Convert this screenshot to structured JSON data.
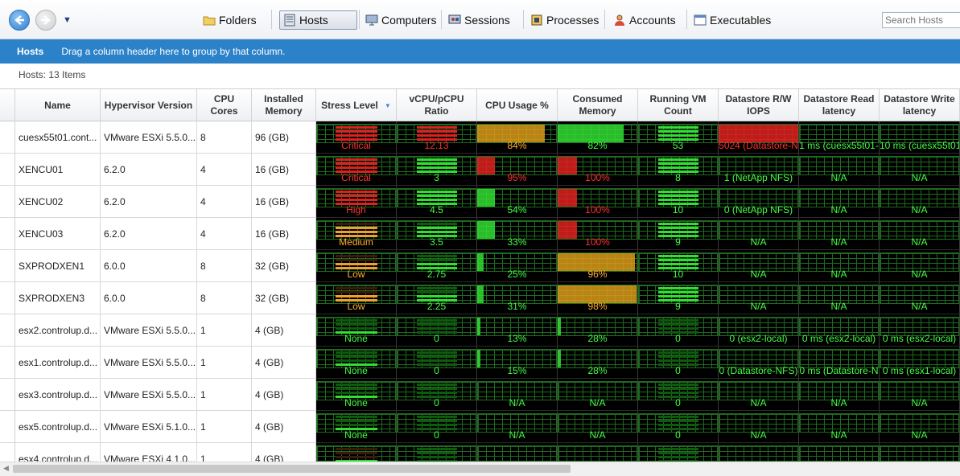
{
  "toolbar": {
    "tabs": [
      {
        "label": "Folders",
        "icon": "folder-icon"
      },
      {
        "label": "Hosts",
        "icon": "hosts-icon"
      },
      {
        "label": "Computers",
        "icon": "computer-icon"
      },
      {
        "label": "Sessions",
        "icon": "sessions-icon"
      },
      {
        "label": "Processes",
        "icon": "processes-icon"
      },
      {
        "label": "Accounts",
        "icon": "accounts-icon"
      },
      {
        "label": "Executables",
        "icon": "executables-icon"
      }
    ],
    "active_tab": "Hosts",
    "search_placeholder": "Search Hosts"
  },
  "groupbar": {
    "title": "Hosts",
    "hint": "Drag a column header here to group by that column."
  },
  "count_label": "Hosts: 13 Items",
  "columns": [
    "Name",
    "Hypervisor Version",
    "CPU Cores",
    "Installed Memory",
    "Stress Level",
    "vCPU/pCPU Ratio",
    "CPU Usage %",
    "Consumed Memory",
    "Running VM Count",
    "Datastore R/W IOPS",
    "Datastore Read latency",
    "Datastore Write latency"
  ],
  "sorted_column": "Stress Level",
  "colors": {
    "accent": "#2c82c9",
    "critical": "#e02020",
    "medium": "#f0a030",
    "ok": "#33dd33",
    "warn_fill": "#d99a1a",
    "label_green": "#44ff44",
    "label_red": "#ff3030",
    "label_orange": "#ffb030"
  },
  "rows": [
    {
      "name": "cuesx55t01.cont...",
      "hypervisor": "VMware ESXi 5.5.0...",
      "cores": "8",
      "memory": "96 (GB)",
      "stress": "Critical",
      "stress_level": 5,
      "ratio": "12.13",
      "ratio_bars": 4,
      "ratio_state": "red",
      "cpu": "84%",
      "cpu_pct": 84,
      "mem": "82%",
      "mem_pct": 82,
      "vms": "53",
      "vm_bars": 4,
      "iops": "5024 (Datastore-N",
      "iops_state": "red",
      "read": "1 ms (cuesx55t01-",
      "write": "10 ms (cuesx55t01"
    },
    {
      "name": "XENCU01",
      "hypervisor": "6.2.0",
      "cores": "4",
      "memory": "16 (GB)",
      "stress": "Critical",
      "stress_level": 5,
      "ratio": "3",
      "ratio_bars": 4,
      "ratio_state": "green",
      "cpu": "95%",
      "cpu_pct": 22,
      "mem": "100%",
      "mem_pct": 24,
      "vms": "8",
      "vm_bars": 4,
      "iops": "1 (NetApp NFS)",
      "iops_state": "green",
      "read": "N/A",
      "write": "N/A"
    },
    {
      "name": "XENCU02",
      "hypervisor": "6.2.0",
      "cores": "4",
      "memory": "16 (GB)",
      "stress": "High",
      "stress_level": 4,
      "ratio": "4.5",
      "ratio_bars": 4,
      "ratio_state": "green",
      "cpu": "54%",
      "cpu_pct": 22,
      "mem": "100%",
      "mem_pct": 24,
      "vms": "10",
      "vm_bars": 4,
      "iops": "0 (NetApp NFS)",
      "iops_state": "green",
      "read": "N/A",
      "write": "N/A"
    },
    {
      "name": "XENCU03",
      "hypervisor": "6.2.0",
      "cores": "4",
      "memory": "16 (GB)",
      "stress": "Medium",
      "stress_level": 3,
      "ratio": "3.5",
      "ratio_bars": 3,
      "ratio_state": "green",
      "cpu": "33%",
      "cpu_pct": 22,
      "mem": "100%",
      "mem_pct": 24,
      "vms": "9",
      "vm_bars": 4,
      "iops": "N/A",
      "iops_state": "green",
      "read": "N/A",
      "write": "N/A"
    },
    {
      "name": "SXPRODXEN1",
      "hypervisor": "6.0.0",
      "cores": "8",
      "memory": "32 (GB)",
      "stress": "Low",
      "stress_level": 2,
      "ratio": "2.75",
      "ratio_bars": 2,
      "ratio_state": "green",
      "cpu": "25%",
      "cpu_pct": 8,
      "mem": "96%",
      "mem_pct": 96,
      "vms": "10",
      "vm_bars": 4,
      "iops": "N/A",
      "iops_state": "green",
      "read": "N/A",
      "write": "N/A"
    },
    {
      "name": "SXPRODXEN3",
      "hypervisor": "6.0.0",
      "cores": "8",
      "memory": "32 (GB)",
      "stress": "Low",
      "stress_level": 2,
      "ratio": "2.25",
      "ratio_bars": 2,
      "ratio_state": "green",
      "cpu": "31%",
      "cpu_pct": 8,
      "mem": "98%",
      "mem_pct": 98,
      "vms": "9",
      "vm_bars": 4,
      "iops": "N/A",
      "iops_state": "green",
      "read": "N/A",
      "write": "N/A"
    },
    {
      "name": "esx2.controlup.d...",
      "hypervisor": "VMware ESXi 5.5.0...",
      "cores": "1",
      "memory": "4 (GB)",
      "stress": "None",
      "stress_level": 1,
      "ratio": "0",
      "ratio_bars": 0,
      "ratio_state": "green",
      "cpu": "13%",
      "cpu_pct": 4,
      "mem": "28%",
      "mem_pct": 4,
      "vms": "0",
      "vm_bars": 0,
      "iops": "0 (esx2-local)",
      "iops_state": "green",
      "read": "0 ms (esx2-local)",
      "write": "0 ms (esx2-local)"
    },
    {
      "name": "esx1.controlup.d...",
      "hypervisor": "VMware ESXi 5.5.0...",
      "cores": "1",
      "memory": "4 (GB)",
      "stress": "None",
      "stress_level": 1,
      "ratio": "0",
      "ratio_bars": 0,
      "ratio_state": "green",
      "cpu": "15%",
      "cpu_pct": 4,
      "mem": "28%",
      "mem_pct": 4,
      "vms": "0",
      "vm_bars": 0,
      "iops": "0 (Datastore-NFS)",
      "iops_state": "green",
      "read": "0 ms (Datastore-N",
      "write": "0 ms (esx1-local)"
    },
    {
      "name": "esx3.controlup.d...",
      "hypervisor": "VMware ESXi 5.5.0...",
      "cores": "1",
      "memory": "4 (GB)",
      "stress": "None",
      "stress_level": 1,
      "ratio": "0",
      "ratio_bars": 0,
      "ratio_state": "green",
      "cpu": "N/A",
      "cpu_pct": 0,
      "mem": "N/A",
      "mem_pct": 0,
      "vms": "0",
      "vm_bars": 0,
      "iops": "N/A",
      "iops_state": "green",
      "read": "N/A",
      "write": "N/A"
    },
    {
      "name": "esx5.controlup.d...",
      "hypervisor": "VMware ESXi 5.1.0...",
      "cores": "1",
      "memory": "4 (GB)",
      "stress": "None",
      "stress_level": 1,
      "ratio": "0",
      "ratio_bars": 0,
      "ratio_state": "green",
      "cpu": "N/A",
      "cpu_pct": 0,
      "mem": "N/A",
      "mem_pct": 0,
      "vms": "0",
      "vm_bars": 0,
      "iops": "N/A",
      "iops_state": "green",
      "read": "N/A",
      "write": "N/A"
    },
    {
      "name": "esx4.controlup.d...",
      "hypervisor": "VMware ESXi 4.1.0...",
      "cores": "1",
      "memory": "4 (GB)",
      "stress": "",
      "stress_level": 1,
      "ratio": "",
      "ratio_bars": 0,
      "ratio_state": "green",
      "cpu": "",
      "cpu_pct": 0,
      "mem": "",
      "mem_pct": 0,
      "vms": "",
      "vm_bars": 0,
      "iops": "",
      "iops_state": "green",
      "read": "",
      "write": ""
    }
  ]
}
